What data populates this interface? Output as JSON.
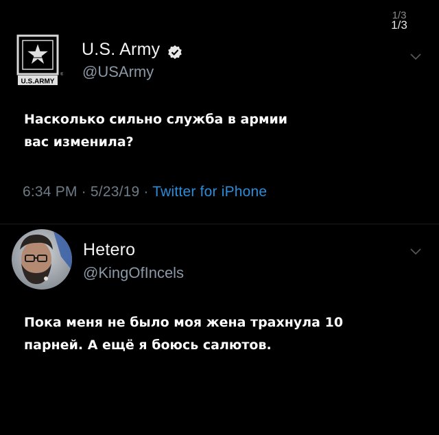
{
  "page_counter": {
    "ghost": "1/3",
    "current": "1/3"
  },
  "tweet": {
    "author_name": "U.S. Army",
    "author_handle": "@USArmy",
    "logo_text": "U.S.ARMY",
    "text_line1": "Насколько сильно служба в армии",
    "text_line2": "вас изменила?",
    "time": "6:34 PM",
    "date": "5/23/19",
    "source": "Twitter for iPhone",
    "separator": "·"
  },
  "reply": {
    "author_name": "Hetero",
    "author_handle": "@KingOfIncels",
    "text_line1": "Пока меня не было моя жена трахнула 10",
    "text_line2": "парней. А ещё я боюсь салютов."
  },
  "colors": {
    "background": "#000000",
    "handle": "#8b98a5",
    "link": "#2b8cd8",
    "verified": "#e8e8e8"
  },
  "icons": {
    "verified": "verified-badge-icon",
    "chevron": "chevron-down-icon",
    "logo": "army-star-logo"
  }
}
